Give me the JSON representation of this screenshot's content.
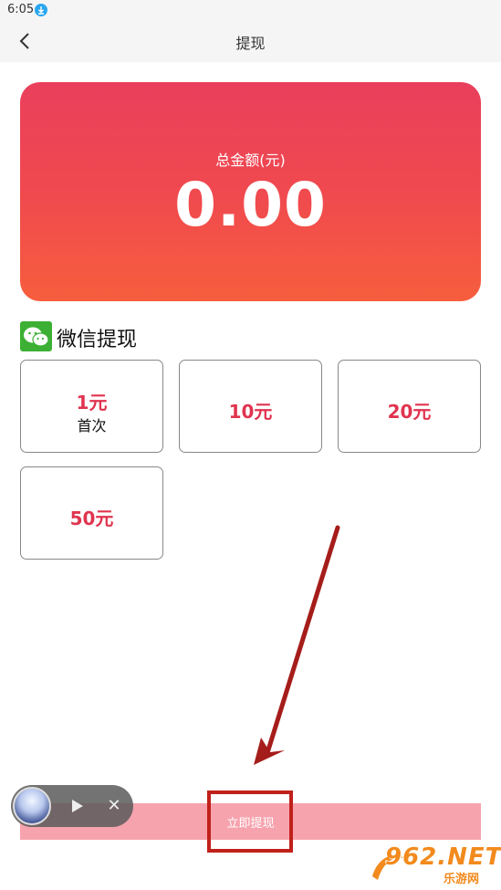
{
  "status_bar": {
    "time": "6:05"
  },
  "header": {
    "title": "提现"
  },
  "balance": {
    "label": "总金额(元)",
    "amount": "0.00"
  },
  "withdraw_section": {
    "title": "微信提现",
    "options": [
      {
        "value": "1元",
        "note": "首次"
      },
      {
        "value": "10元"
      },
      {
        "value": "20元"
      },
      {
        "value": "50元"
      }
    ]
  },
  "submit": {
    "label": "立即提现"
  },
  "watermark": {
    "main": "962.NET",
    "sub": "乐游网"
  },
  "colors": {
    "accent": "#e0344f",
    "card_top": "#ea3f5c",
    "card_bottom": "#f65e3d",
    "button": "#f6a3ae",
    "wechat": "#3cb034",
    "annotation": "#c0211a"
  }
}
